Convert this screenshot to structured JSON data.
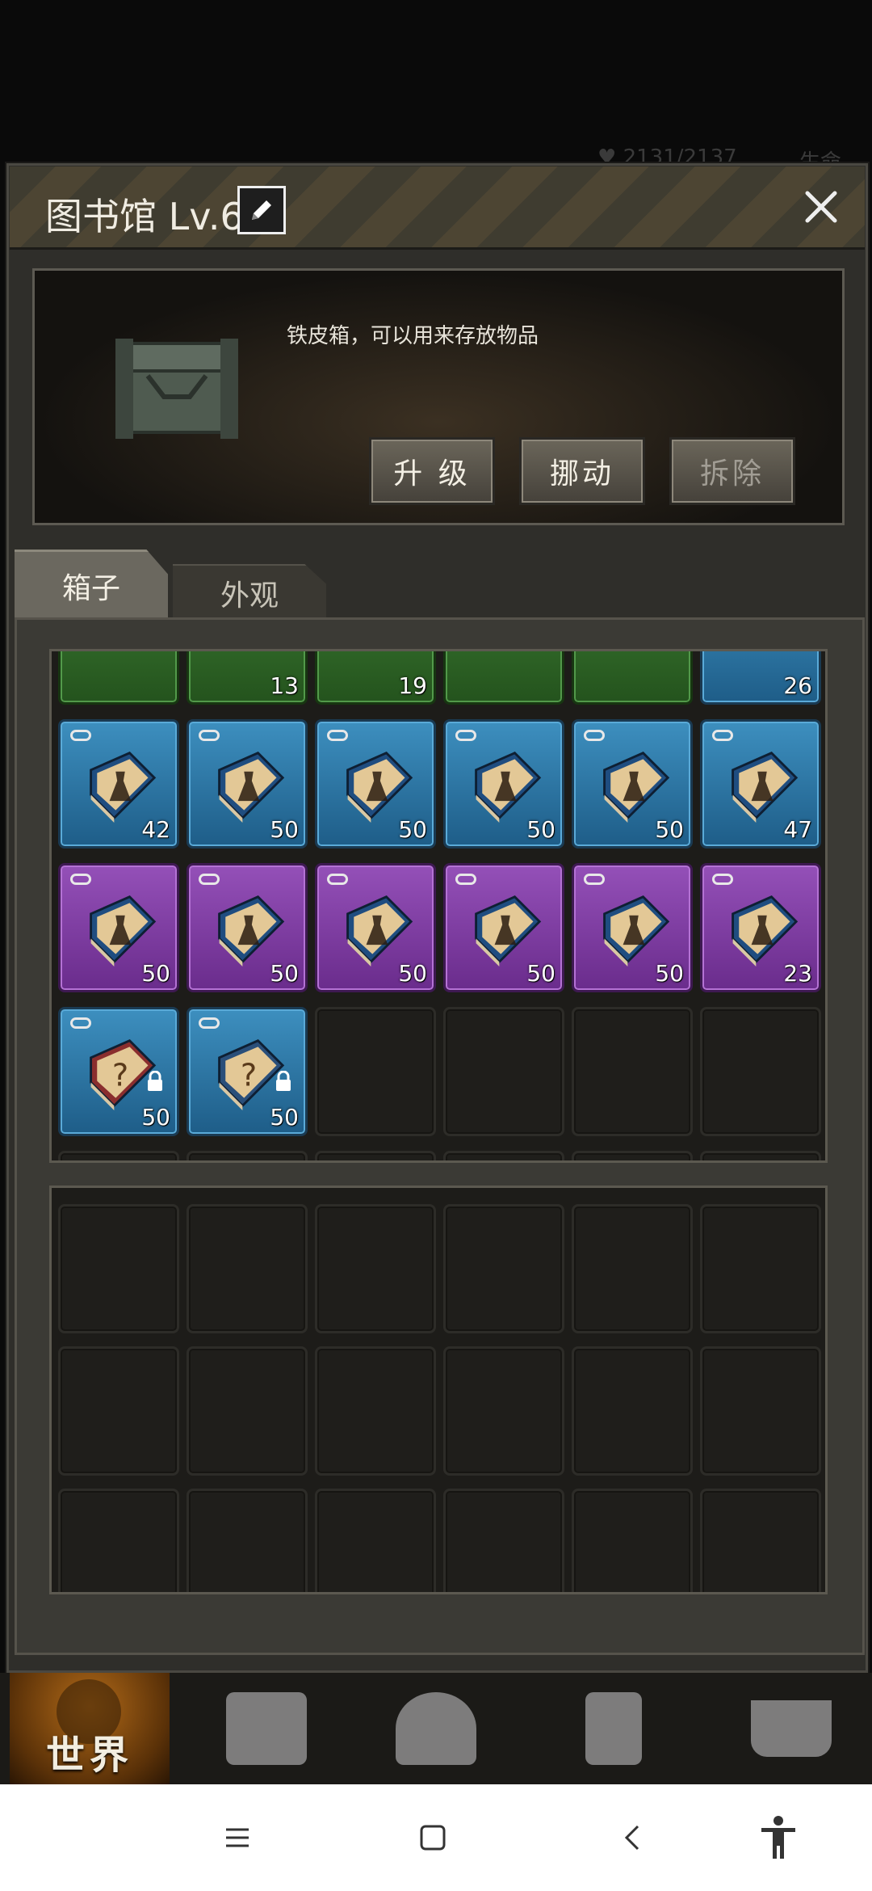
{
  "background_hints": {
    "top_left": "♥ 2131/2137",
    "top_right": "生命"
  },
  "panel": {
    "title": "图书馆 Lv.6",
    "item_description": "铁皮箱，可以用来存放物品",
    "buttons": {
      "upgrade": "升 级",
      "move": "挪动",
      "dismantle": "拆除"
    },
    "tabs": [
      {
        "label": "箱子",
        "active": true
      },
      {
        "label": "外观",
        "active": false
      }
    ]
  },
  "storage": {
    "partial_row_counts": [
      "",
      "13",
      "19",
      "",
      "",
      "26"
    ],
    "rows": [
      {
        "rarity": "blue",
        "counts": [
          "42",
          "50",
          "50",
          "50",
          "50",
          "47"
        ]
      },
      {
        "rarity": "purple",
        "counts": [
          "50",
          "50",
          "50",
          "50",
          "50",
          "23"
        ]
      },
      {
        "rarity": "mixed",
        "counts": [
          "50",
          "50"
        ]
      }
    ]
  },
  "game_nav": {
    "world_label": "世界"
  },
  "colors": {
    "blue_slot": "#2f78a8",
    "purple_slot": "#7d3aa0",
    "green_slot": "#2f6a27",
    "panel": "#2f2e2a"
  }
}
